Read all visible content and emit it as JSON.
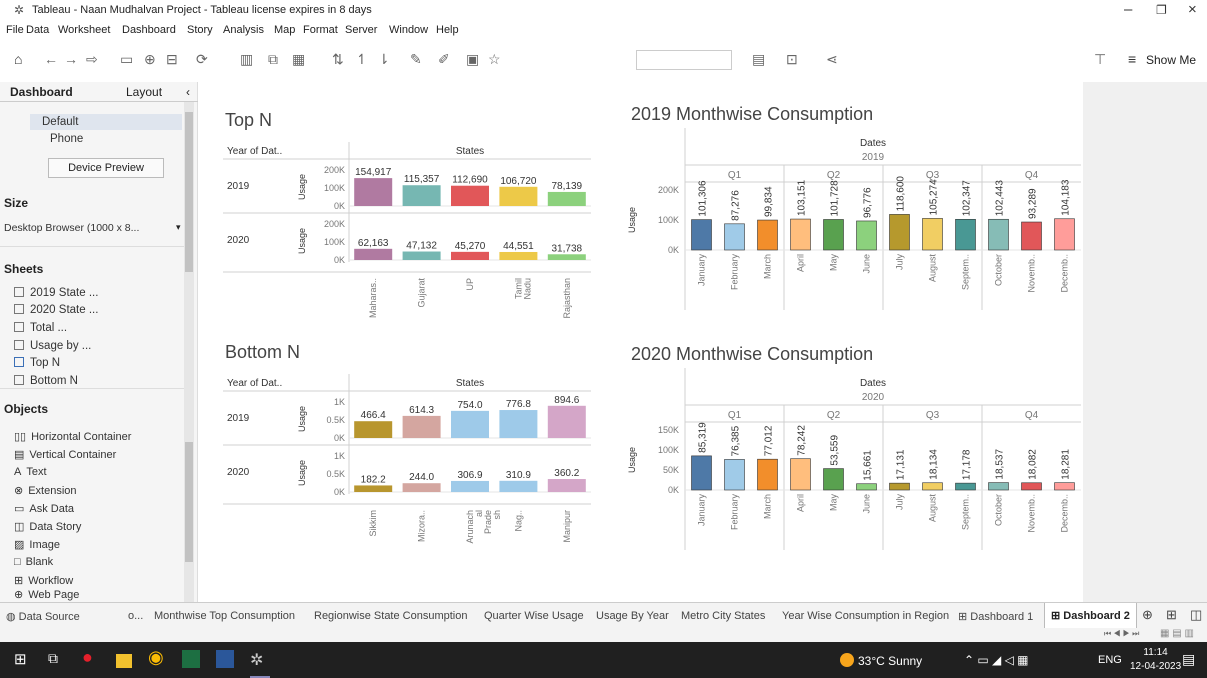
{
  "window": {
    "title": "Tableau - Naan Mudhalvan Project - Tableau license expires in 8 days"
  },
  "menu": [
    "File",
    "Data",
    "Worksheet",
    "Dashboard",
    "Story",
    "Analysis",
    "Map",
    "Format",
    "Server",
    "Window",
    "Help"
  ],
  "toolbar": {
    "show_me": "Show Me"
  },
  "left_panel": {
    "tab_dashboard": "Dashboard",
    "tab_layout": "Layout",
    "devices": [
      "Default",
      "Phone"
    ],
    "device_preview": "Device Preview",
    "size_title": "Size",
    "size_value": "Desktop Browser (1000 x 8...",
    "sheets_title": "Sheets",
    "sheets": [
      "2019 State ...",
      "2020 State ...",
      "Total ...",
      "Usage by ...",
      "Top N",
      "Bottom N"
    ],
    "objects_title": "Objects",
    "objects": [
      "Horizontal Container",
      "Vertical Container",
      "Text",
      "Extension",
      "Ask Data",
      "Data Story",
      "Image",
      "Blank",
      "Workflow",
      "Web Page"
    ]
  },
  "topn": {
    "title": "Top N",
    "col_year": "Year of Dat..",
    "col_states": "States",
    "measure": "Usage",
    "ticks": [
      "200K",
      "100K",
      "0K"
    ]
  },
  "bottomn": {
    "title": "Bottom N",
    "col_year": "Year of Dat..",
    "col_states": "States",
    "measure": "Usage",
    "ticks": [
      "1K",
      "0.5K",
      "0K"
    ]
  },
  "m2019": {
    "title": "2019 Monthwise Consumption",
    "dates": "Dates",
    "year": "2019",
    "measure": "Usage",
    "quarters": [
      "Q1",
      "Q2",
      "Q3",
      "Q4"
    ],
    "ticks": [
      "200K",
      "100K",
      "0K"
    ]
  },
  "m2020": {
    "title": "2020 Monthwise Consumption",
    "dates": "Dates",
    "year": "2020",
    "measure": "Usage",
    "quarters": [
      "Q1",
      "Q2",
      "Q3",
      "Q4"
    ],
    "ticks": [
      "150K",
      "100K",
      "50K",
      "0K"
    ]
  },
  "chart_data": [
    {
      "type": "bar",
      "title": "Top N",
      "xlabel": "States",
      "ylabel": "Usage",
      "ylim": [
        0,
        200000
      ],
      "rows": [
        {
          "year": "2019",
          "categories": [
            "Maharas..",
            "Gujarat",
            "UP",
            "Tamil Nadu",
            "Rajasthan"
          ],
          "values": [
            154917,
            115357,
            112690,
            106720,
            78139
          ],
          "labels": [
            "154,917",
            "115,357",
            "112,690",
            "106,720",
            "78,139"
          ]
        },
        {
          "year": "2020",
          "categories": [
            "Maharas..",
            "Gujarat",
            "UP",
            "Tamil Nadu",
            "Rajasthan"
          ],
          "values": [
            62163,
            47132,
            45270,
            44551,
            31738
          ],
          "labels": [
            "62,163",
            "47,132",
            "45,270",
            "44,551",
            "31,738"
          ]
        }
      ],
      "colors": [
        "#b07aa1",
        "#76b7b2",
        "#e15759",
        "#edc948",
        "#8cd17d"
      ]
    },
    {
      "type": "bar",
      "title": "Bottom N",
      "xlabel": "States",
      "ylabel": "Usage",
      "ylim": [
        0,
        1000
      ],
      "rows": [
        {
          "year": "2019",
          "values": [
            466.4,
            614.3,
            754.0,
            776.8,
            894.6
          ],
          "labels": [
            "466.4",
            "614.3",
            "754.0",
            "776.8",
            "894.6"
          ]
        },
        {
          "year": "2020",
          "values": [
            182.2,
            244.0,
            306.9,
            310.9,
            360.2
          ],
          "labels": [
            "182.2",
            "244.0",
            "306.9",
            "310.9",
            "360.2"
          ]
        }
      ],
      "categories": [
        "Sikkim",
        "Mizora..",
        "Arunach al Prade sh",
        "Nag..",
        "Manipur"
      ],
      "colors": [
        "#b8962e",
        "#d4a6a0",
        "#9ecae9",
        "#9ecae9",
        "#d4a6c8"
      ]
    },
    {
      "type": "bar",
      "title": "2019 Monthwise Consumption",
      "xlabel": "Dates",
      "ylabel": "Usage",
      "ylim": [
        0,
        200000
      ],
      "categories": [
        "January",
        "February",
        "March",
        "April",
        "May",
        "June",
        "July",
        "August",
        "Septem..",
        "October",
        "Novemb..",
        "Decemb.."
      ],
      "values": [
        101306,
        87276,
        99834,
        103151,
        101728,
        96776,
        118600,
        105274,
        102347,
        102443,
        93289,
        104183
      ],
      "labels": [
        "101,306",
        "87,276",
        "99,834",
        "103,151",
        "101,728",
        "96,776",
        "118,600",
        "105,274",
        "102,347",
        "102,443",
        "93,289",
        "104,183"
      ],
      "colors": [
        "#4e79a7",
        "#a0cbe8",
        "#f28e2b",
        "#ffbe7d",
        "#59a14f",
        "#8cd17d",
        "#b6992d",
        "#f1ce63",
        "#499894",
        "#86bcb6",
        "#e15759",
        "#ff9d9a"
      ]
    },
    {
      "type": "bar",
      "title": "2020 Monthwise Consumption",
      "xlabel": "Dates",
      "ylabel": "Usage",
      "ylim": [
        0,
        150000
      ],
      "categories": [
        "January",
        "February",
        "March",
        "April",
        "May",
        "June",
        "July",
        "August",
        "Septem..",
        "October",
        "Novemb..",
        "Decemb.."
      ],
      "values": [
        85319,
        76385,
        77012,
        78242,
        53559,
        15661,
        17131,
        18134,
        17178,
        18537,
        18082,
        18281
      ],
      "labels": [
        "85,319",
        "76,385",
        "77,012",
        "78,242",
        "53,559",
        "15,661",
        "17,131",
        "18,134",
        "17,178",
        "18,537",
        "18,082",
        "18,281"
      ],
      "colors": [
        "#4e79a7",
        "#a0cbe8",
        "#f28e2b",
        "#ffbe7d",
        "#59a14f",
        "#8cd17d",
        "#b6992d",
        "#f1ce63",
        "#499894",
        "#86bcb6",
        "#e15759",
        "#ff9d9a"
      ]
    }
  ],
  "sheet_tabs": [
    "Data Source",
    "o...",
    "Monthwise Top Consumption",
    "Regionwise State Consumption",
    "Quarter Wise Usage",
    "Usage By Year",
    "Metro City States",
    "Year Wise Consumption in Region",
    "Dashboard 1",
    "Dashboard 2"
  ],
  "taskbar": {
    "weather": "33°C  Sunny",
    "lang": "ENG",
    "time": "11:14",
    "date": "12-04-2023"
  }
}
